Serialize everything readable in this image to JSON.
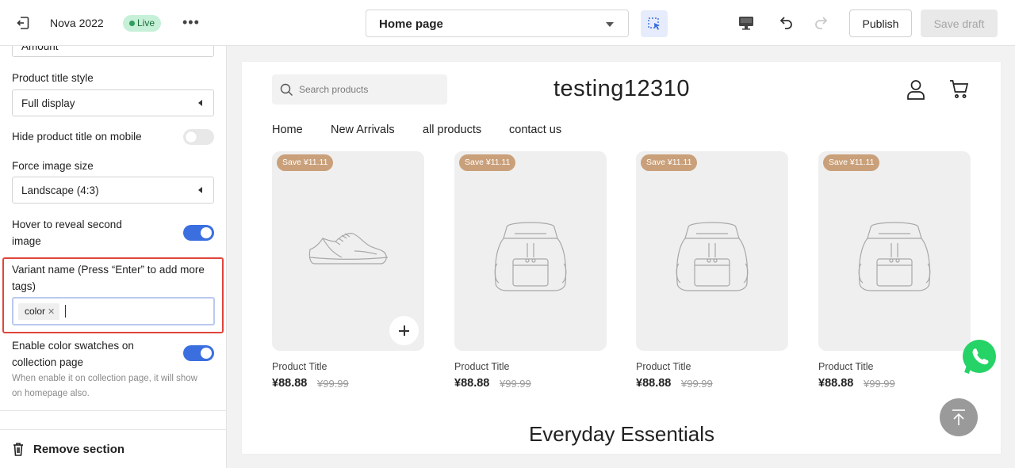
{
  "topbar": {
    "store_name": "Nova 2022",
    "live_label": "Live",
    "more_label": "•••",
    "page_select": "Home page",
    "publish_label": "Publish",
    "save_draft_label": "Save draft"
  },
  "sidebar": {
    "partial_select_value": "Amount",
    "product_title_style": {
      "label": "Product title style",
      "value": "Full display"
    },
    "hide_title_mobile": {
      "label": "Hide product title on mobile",
      "enabled": false
    },
    "force_image_size": {
      "label": "Force image size",
      "value": "Landscape (4:3)"
    },
    "hover_reveal": {
      "label_line1": "Hover to reveal second",
      "label_line2": "image",
      "enabled": true
    },
    "variant_name": {
      "label_line1": "Variant name (Press “Enter” to add more",
      "label_line2": "tags)",
      "tags": [
        "color"
      ]
    },
    "color_swatches": {
      "label_line1": "Enable color swatches on",
      "label_line2": "collection page",
      "enabled": true,
      "help_line1": "When enable it on collection page, it will show",
      "help_line2": "on homepage also."
    },
    "remove_section_label": "Remove section"
  },
  "preview": {
    "search_placeholder": "Search products",
    "store_title": "testing12310",
    "nav": [
      "Home",
      "New Arrivals",
      "all products",
      "contact us"
    ],
    "products": [
      {
        "badge": "Save ¥11.11",
        "image": "sneaker",
        "title": "Product Title",
        "price": "¥88.88",
        "old_price": "¥99.99"
      },
      {
        "badge": "Save ¥11.11",
        "image": "backpack",
        "title": "Product Title",
        "price": "¥88.88",
        "old_price": "¥99.99"
      },
      {
        "badge": "Save ¥11.11",
        "image": "backpack",
        "title": "Product Title",
        "price": "¥88.88",
        "old_price": "¥99.99"
      },
      {
        "badge": "Save ¥11.11",
        "image": "backpack",
        "title": "Product Title",
        "price": "¥88.88",
        "old_price": "¥99.99"
      }
    ],
    "section_heading": "Everyday Essentials"
  },
  "colors": {
    "accent": "#3b6fe0",
    "live_badge": "#c6f0d8",
    "save_badge": "#c9a07a",
    "highlight": "#e0453b",
    "whatsapp": "#25d366"
  }
}
